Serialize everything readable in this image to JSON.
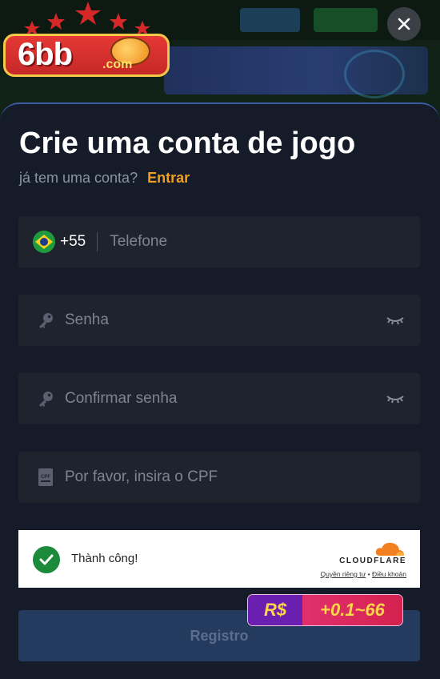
{
  "brand": {
    "logo_text": "6bb",
    "logo_suffix": ".com"
  },
  "modal": {
    "title": "Crie uma conta de jogo",
    "subtitle": "já tem uma conta?",
    "login_link": "Entrar",
    "close_icon": "close-icon"
  },
  "form": {
    "phone": {
      "country_code": "+55",
      "placeholder": "Telefone",
      "value": "",
      "flag_icon": "brazil-flag-icon"
    },
    "password": {
      "placeholder": "Senha",
      "value": "",
      "icon": "key-icon",
      "toggle_icon": "eye-closed-icon"
    },
    "confirm_password": {
      "placeholder": "Confirmar senha",
      "value": "",
      "icon": "key-icon",
      "toggle_icon": "eye-closed-icon"
    },
    "cpf": {
      "placeholder": "Por favor, insira o CPF",
      "value": "",
      "icon": "cpf-card-icon"
    },
    "submit_label": "Registro"
  },
  "captcha": {
    "status_text": "Thành công!",
    "brand": "CLOUDFLARE",
    "privacy_link": "Quyền riêng tư",
    "separator": "•",
    "terms_link": "Điều khoản",
    "status_color": "#1b8a3a"
  },
  "bonus": {
    "currency": "R$",
    "value": "+0.1~66"
  },
  "colors": {
    "accent": "#f0a020",
    "panel_bg": "#151b28",
    "field_bg": "#1e232e",
    "button_bg": "#243a5f"
  }
}
